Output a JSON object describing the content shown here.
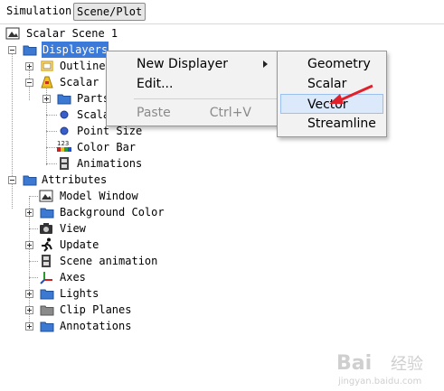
{
  "tabs": {
    "simulation": "Simulation",
    "scene_plot": "Scene/Plot"
  },
  "tree": {
    "root": "Scalar Scene 1",
    "displayers": "Displayers",
    "outline": "Outline",
    "scalar": "Scalar",
    "parts": "Parts",
    "scalar_bar": "Scala",
    "point_size": "Point Size",
    "color_bar": "Color Bar",
    "color_bar_badge": "123",
    "animations": "Animations",
    "attributes": "Attributes",
    "model_window": "Model Window",
    "background_color": "Background Color",
    "view": "View",
    "update": "Update",
    "scene_animation": "Scene animation",
    "axes": "Axes",
    "lights": "Lights",
    "clip_planes": "Clip Planes",
    "annotations": "Annotations"
  },
  "context_menu": {
    "new_displayer": "New Displayer",
    "edit": "Edit...",
    "paste": "Paste",
    "paste_shortcut": "Ctrl+V"
  },
  "submenu": {
    "geometry": "Geometry",
    "scalar": "Scalar",
    "vector": "Vector",
    "streamline": "Streamline"
  },
  "watermark": {
    "text": "Bai",
    "suffix": "经验",
    "url": "jingyan.baidu.com"
  },
  "colors": {
    "selection": "#3b7ad9",
    "folder": "#3b79d3",
    "highlight": "#dce9fb",
    "pointer_arrow": "#e0202a"
  }
}
